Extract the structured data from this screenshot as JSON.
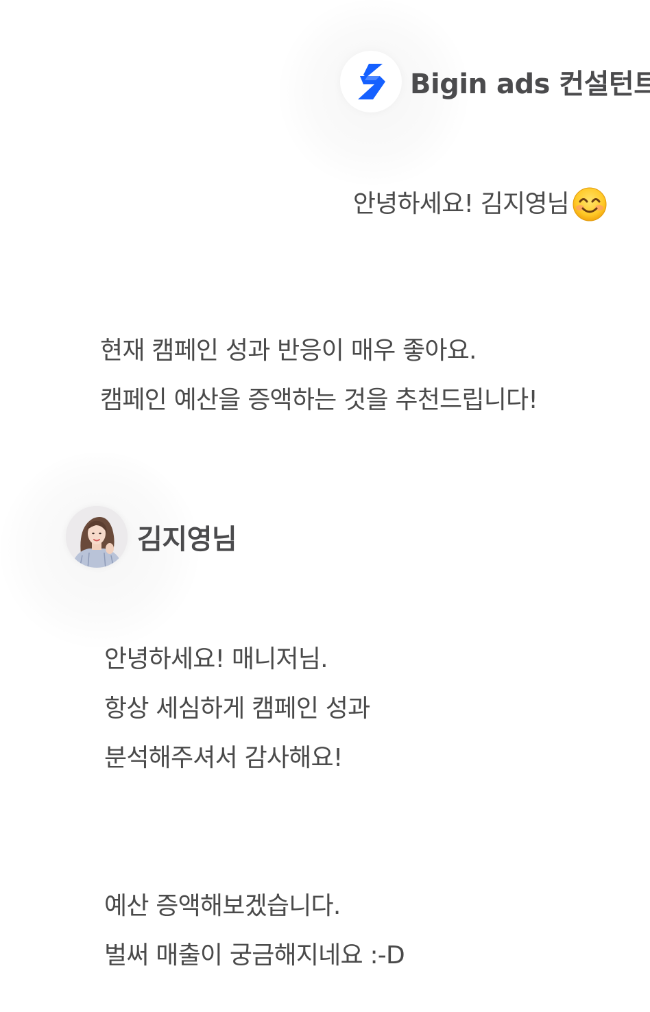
{
  "conversation": {
    "consultant": {
      "name": "Bigin ads 컨설턴트",
      "avatar_icon": "bigin-lightning-logo-icon",
      "brand_color": "#1560FF"
    },
    "client": {
      "name": "김지영님",
      "avatar_icon": "profile-photo-avatar"
    },
    "messages": [
      {
        "from": "consultant",
        "lines": [
          "안녕하세요! 김지영님"
        ],
        "emoji": "smiling-face-emoji"
      },
      {
        "from": "consultant",
        "lines": [
          "현재 캠페인 성과 반응이 매우 좋아요.",
          "캠페인 예산을 증액하는 것을 추천드립니다!"
        ]
      },
      {
        "from": "client",
        "lines": [
          "안녕하세요! 매니저님.",
          "항상 세심하게 캠페인 성과",
          "분석해주셔서 감사해요!"
        ]
      },
      {
        "from": "client",
        "lines": [
          "예산 증액해보겠습니다.",
          "벌써 매출이 궁금해지네요 :-D"
        ]
      }
    ]
  }
}
